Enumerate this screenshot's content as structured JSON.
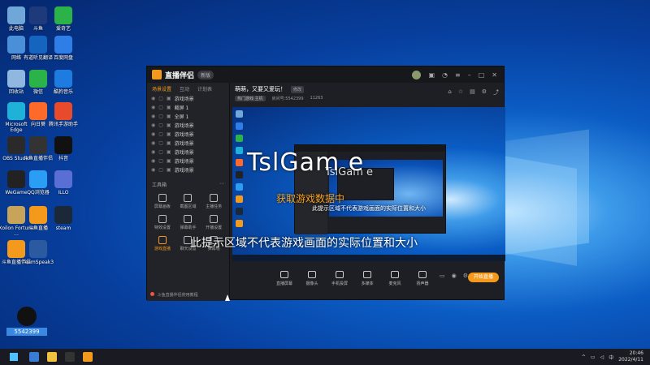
{
  "desktop": {
    "icons": [
      {
        "label": "此电脑",
        "color": "#6fa7d9"
      },
      {
        "label": "斗鱼",
        "color": "#1f3a7a"
      },
      {
        "label": "爱奇艺",
        "color": "#2bb34a"
      },
      {
        "label": "网络",
        "color": "#4a90d9"
      },
      {
        "label": "有道听见翻译",
        "color": "#1565c0"
      },
      {
        "label": "百度网盘",
        "color": "#2f7ee8"
      },
      {
        "label": "回收站",
        "color": "#8fb7e0"
      },
      {
        "label": "微信",
        "color": "#2bb34a"
      },
      {
        "label": "酷狗音乐",
        "color": "#1e7be0"
      },
      {
        "label": "Microsoft Edge",
        "color": "#1fb2d9"
      },
      {
        "label": "向日葵",
        "color": "#ff6a2b"
      },
      {
        "label": "腾讯手游助手",
        "color": "#e84a2c"
      },
      {
        "label": "OBS Studio",
        "color": "#2a2a2a"
      },
      {
        "label": "斗鱼直播伴侣",
        "color": "#333333"
      },
      {
        "label": "抖音",
        "color": "#111111"
      },
      {
        "label": "WeGame",
        "color": "#222222"
      },
      {
        "label": "QQ浏览器",
        "color": "#2a9df4"
      },
      {
        "label": "ILLO",
        "color": "#5a6fd6"
      },
      {
        "label": "Xoilon Fortune ...",
        "color": "#c8a45a"
      },
      {
        "label": "斗鱼直播",
        "color": "#f39a1c"
      },
      {
        "label": "steam",
        "color": "#1b2838"
      },
      {
        "label": "斗鱼直播伴侣",
        "color": "#f39a1c"
      },
      {
        "label": "TeamSpeak3",
        "color": "#2c5aa0"
      }
    ],
    "qq_id": "5542399"
  },
  "app": {
    "brand": "直播伴侣",
    "version": "新版",
    "left_tabs": [
      "场景设置",
      "互动",
      "计划表"
    ],
    "sources": [
      "游戏场景",
      "截屏 1",
      "全屏 1",
      "游戏场景",
      "游戏场景",
      "游戏场景",
      "游戏场景",
      "游戏场景",
      "游戏场景"
    ],
    "tools_title": "工具箱",
    "tools": [
      {
        "label": "屏幕画板",
        "active": false
      },
      {
        "label": "截图区域",
        "active": false
      },
      {
        "label": "主播任务",
        "active": false
      },
      {
        "label": "特效设置",
        "active": false
      },
      {
        "label": "弹幕助手",
        "active": false
      },
      {
        "label": "开播设置",
        "active": false
      },
      {
        "label": "游戏直播",
        "active": true
      },
      {
        "label": "聊天设置",
        "active": false
      },
      {
        "label": "弹幕墙",
        "active": false
      }
    ],
    "footer": "斗鱼直播伴侣使用教程",
    "room_title": "萌萌，又要又爱玩！",
    "room_edit": "修改",
    "room_tag": "热门游戏·主机",
    "room_id": "房间号:5542399",
    "viewers": "11263",
    "preview": {
      "big_title": "TslGam  e",
      "overlay2": "TslGam  e",
      "orange_text": "获取游戏数据中",
      "small_tip": "此提示区域不代表游戏画面的实际位置和大小",
      "hint": "此提示区域不代表游戏画面的实际位置和大小"
    },
    "bottom_tools": [
      "直播屏幕",
      "摄像头",
      "手机投屏",
      "多媒体",
      "麦克风",
      "扬声器"
    ],
    "live_button": "开始直播"
  },
  "taskbar": {
    "time": "20:46",
    "date": "2022/4/11"
  }
}
